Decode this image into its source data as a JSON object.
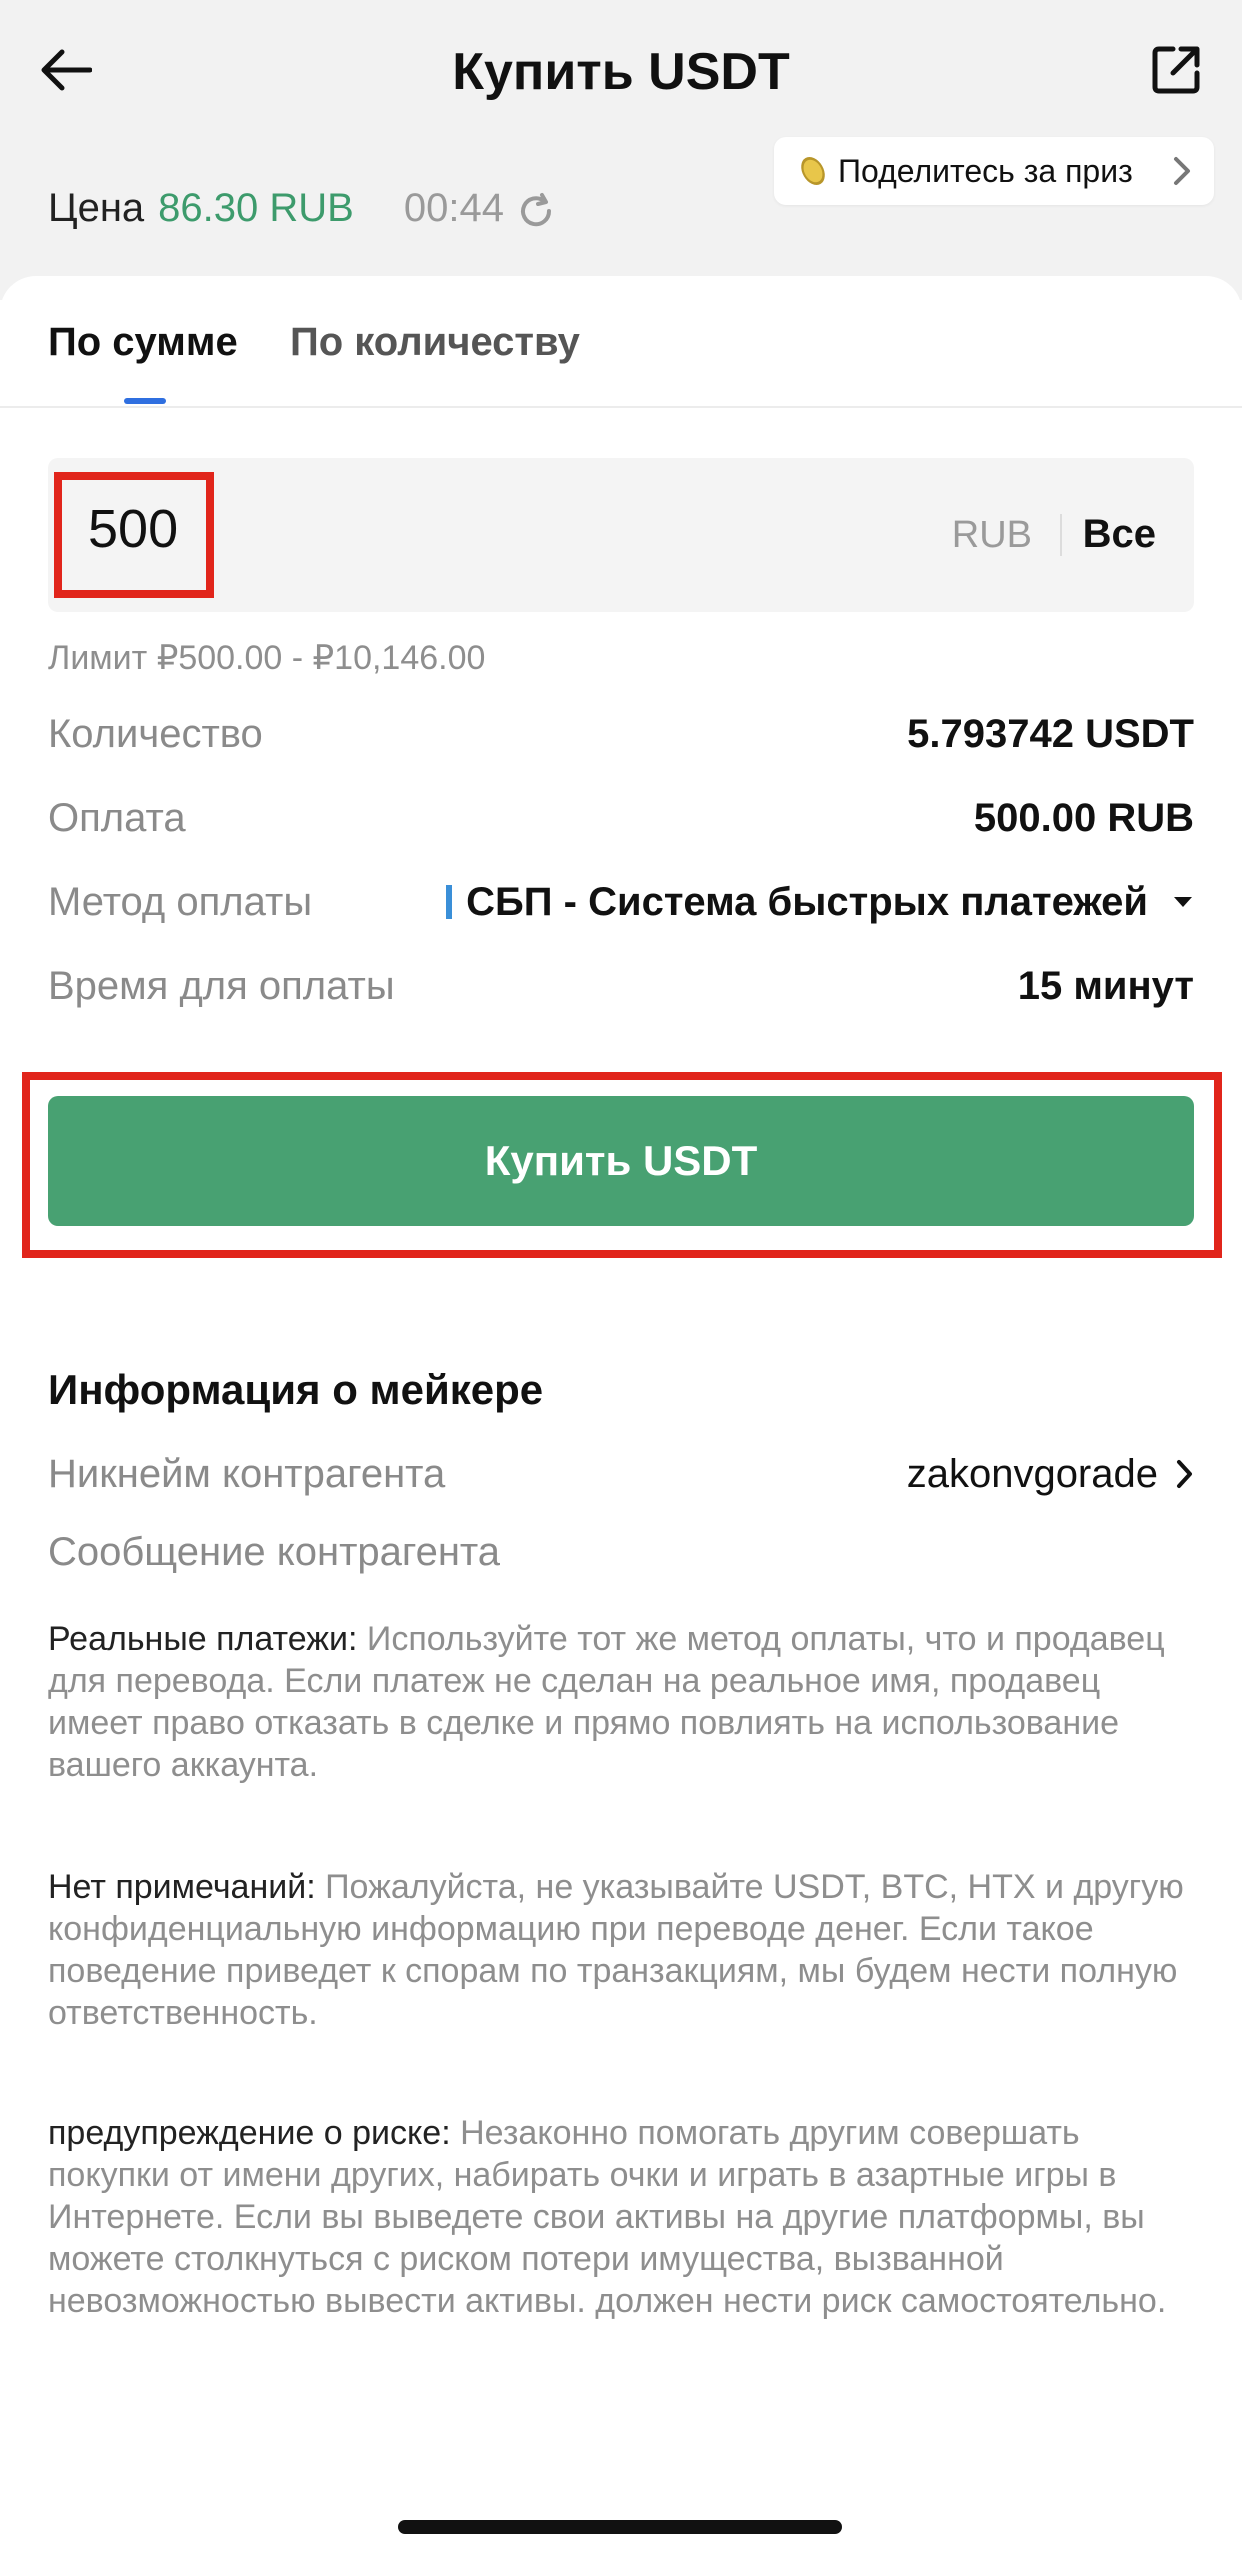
{
  "header": {
    "title": "Купить USDT",
    "promo": "Поделитесь за приз"
  },
  "price": {
    "label": "Цена",
    "value": "86.30 RUB",
    "timer": "00:44"
  },
  "tabs": [
    {
      "label": "По сумме",
      "active": true
    },
    {
      "label": "По количеству",
      "active": false
    }
  ],
  "amount": {
    "value": "500",
    "currency": "RUB",
    "all_label": "Все"
  },
  "limit": "Лимит ₽500.00 - ₽10,146.00",
  "details": [
    {
      "label": "Количество",
      "value": "5.793742 USDT"
    },
    {
      "label": "Оплата",
      "value": "500.00 RUB"
    },
    {
      "label": "Метод оплаты",
      "value": "СБП - Система быстрых платежей"
    },
    {
      "label": "Время для оплаты",
      "value": "15 минут"
    }
  ],
  "buy_button": "Купить USDT",
  "maker": {
    "title": "Информация о мейкере",
    "nick_label": "Никнейм контрагента",
    "nick_value": "zakonvgorade",
    "message_label": "Сообщение контрагента"
  },
  "notes": [
    {
      "lead": "Реальные платежи:",
      "text": "Используйте тот же метод оплаты, что и продавец для перевода. Если платеж не сделан на реальное имя, продавец имеет право отказать в сделке и прямо повлиять на использование вашего аккаунта."
    },
    {
      "lead": "Нет примечаний:",
      "text": "Пожалуйста, не указывайте USDT, BTC, HTX и другую конфиденциальную информацию при переводе денег. Если такое поведение приведет к спорам по транзакциям, мы будем нести полную ответственность."
    },
    {
      "lead": "предупреждение о риске:",
      "text": "Незаконно помогать другим совершать покупки от имени других, набирать очки и играть в азартные игры в Интернете. Если вы выведете свои активы на другие платформы, вы можете столкнуться с риском потери имущества, вызванной невозможностью вывести активы. должен нести риск самостоятельно."
    }
  ],
  "colors": {
    "accent_green": "#48a172",
    "price_green": "#3d9b6c",
    "tab_underline": "#2f6fe0",
    "highlight_red": "#e1251b"
  },
  "icons": [
    "back-arrow-icon",
    "share-external-icon",
    "coin-icon",
    "chevron-right-icon",
    "refresh-icon",
    "caret-down-icon"
  ]
}
